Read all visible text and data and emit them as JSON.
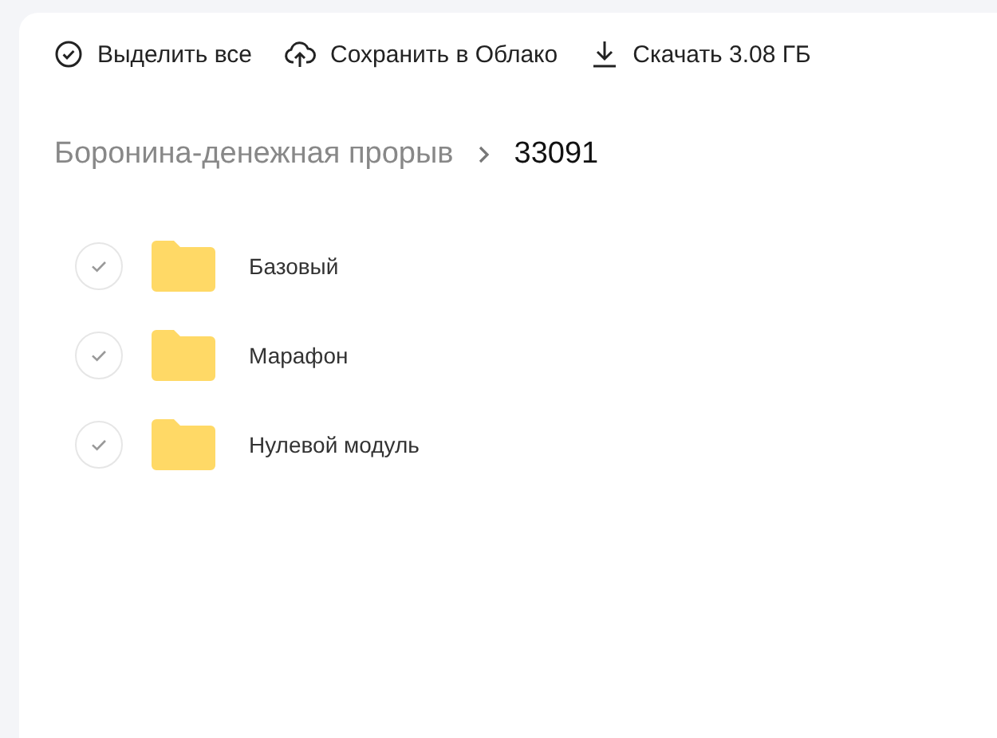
{
  "toolbar": [
    {
      "kind": "select",
      "label": "Выделить все"
    },
    {
      "kind": "cloud",
      "label": "Сохранить в Облако"
    },
    {
      "kind": "download",
      "label": "Скачать 3.08 ГБ"
    }
  ],
  "breadcrumb": {
    "parent": "Боронина-денежная прорыв",
    "current": "33091"
  },
  "folders": [
    {
      "name": "Базовый",
      "selected": false
    },
    {
      "name": "Марафон",
      "selected": false
    },
    {
      "name": "Нулевой модуль",
      "selected": false
    }
  ]
}
